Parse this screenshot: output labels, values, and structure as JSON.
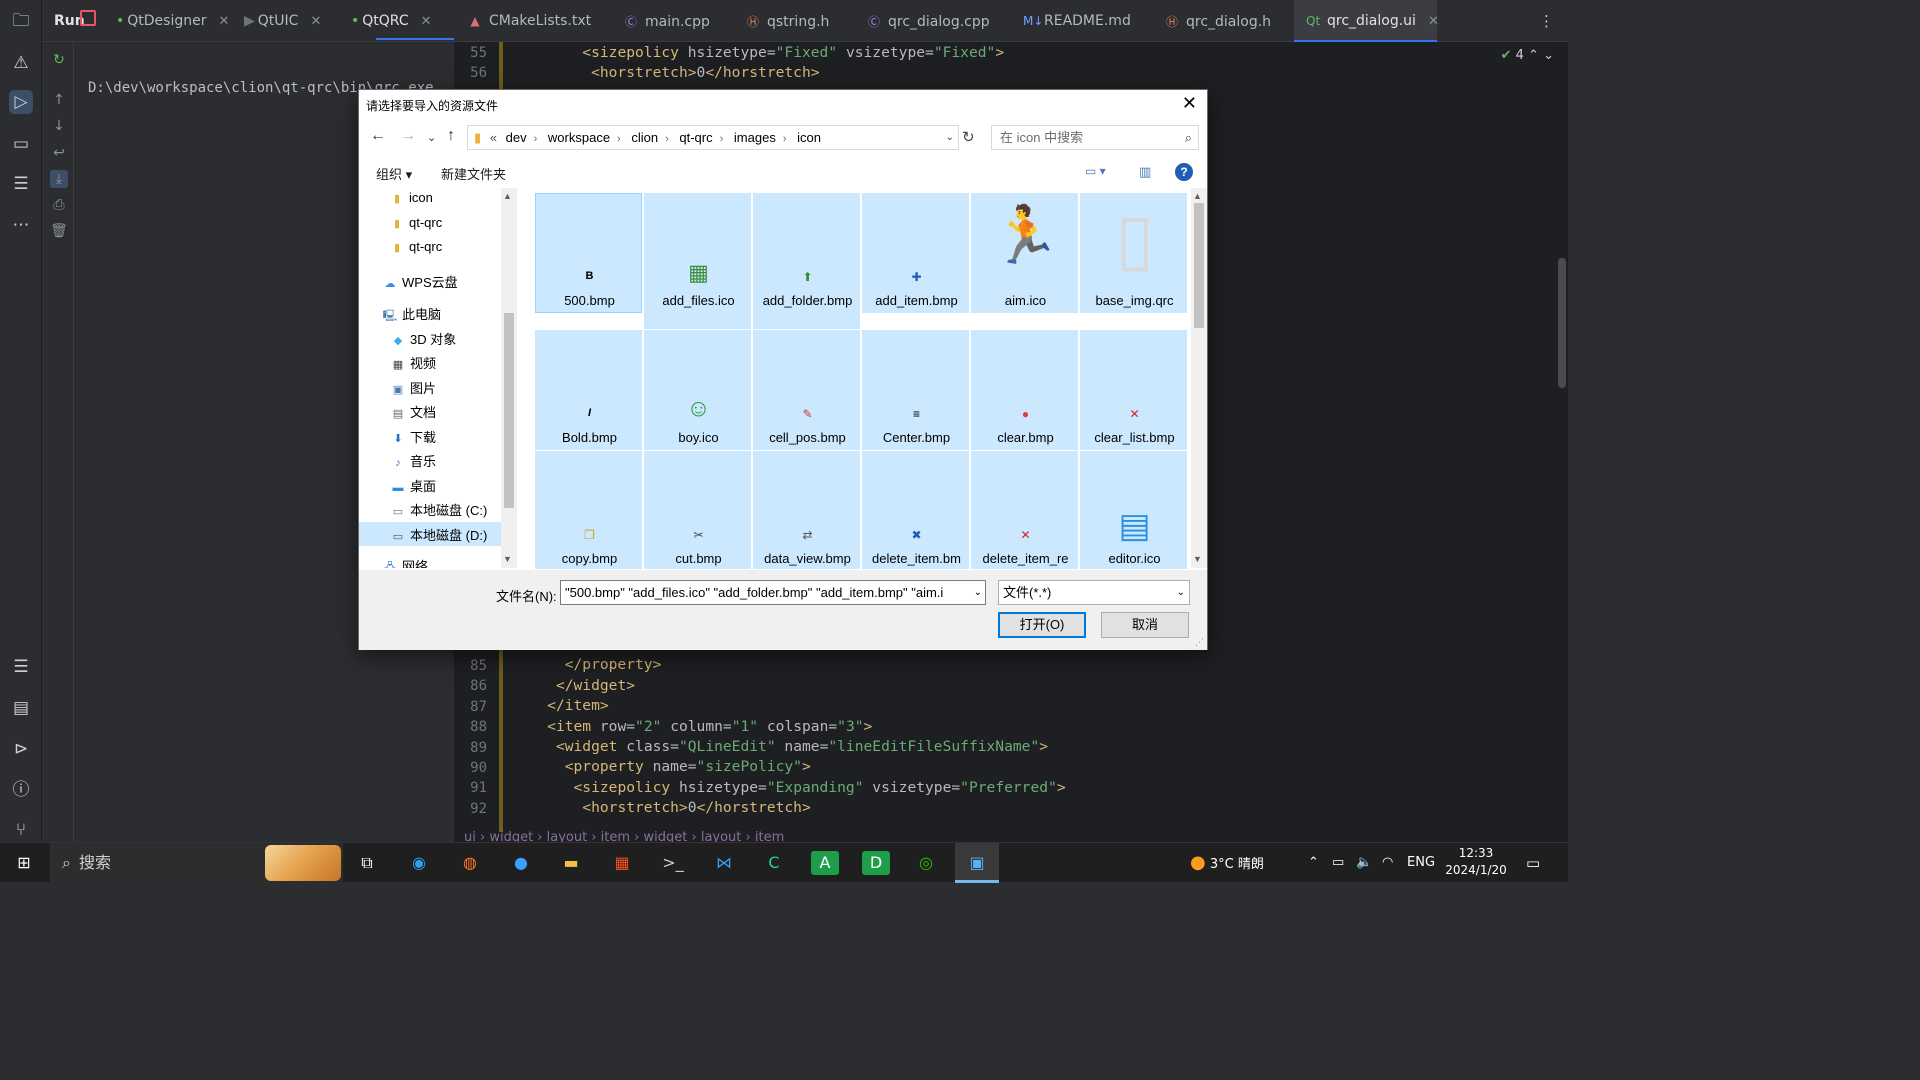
{
  "run_tool": {
    "title": "Run",
    "tabs": [
      {
        "label": "QtDesigner"
      },
      {
        "label": "QtUIC"
      },
      {
        "label": "QtQRC"
      }
    ],
    "console_line": "D:\\dev\\workspace\\clion\\qt-qrc\\bin\\qrc.exe"
  },
  "editor": {
    "tabs": [
      {
        "label": "CMakeLists.txt"
      },
      {
        "label": "main.cpp"
      },
      {
        "label": "qstring.h"
      },
      {
        "label": "qrc_dialog.cpp"
      },
      {
        "label": "README.md"
      },
      {
        "label": "qrc_dialog.h"
      },
      {
        "label": "qrc_dialog.ui"
      }
    ],
    "warnings_count": "4",
    "line_numbers": [
      "55",
      "56",
      "85",
      "86",
      "87",
      "88",
      "89",
      "90",
      "91",
      "92"
    ],
    "breadcrumb": [
      "ui",
      "widget",
      "layout",
      "item",
      "widget",
      "layout",
      "item"
    ]
  },
  "dialog": {
    "title": "请选择要导入的资源文件",
    "path": [
      "dev",
      "workspace",
      "clion",
      "qt-qrc",
      "images",
      "icon"
    ],
    "path_prefix": "«",
    "search_placeholder": "在 icon 中搜索",
    "toolbar": {
      "organize": "组织 ▾",
      "new_folder": "新建文件夹",
      "help": "?"
    },
    "tree": [
      {
        "label": "icon",
        "icon": "folder-icon"
      },
      {
        "label": "qt-qrc",
        "icon": "folder-icon"
      },
      {
        "label": "qt-qrc",
        "icon": "folder-icon"
      },
      {
        "label": "WPS云盘",
        "icon": "cloud-icon"
      },
      {
        "label": "此电脑",
        "icon": "computer-icon"
      },
      {
        "label": "3D 对象",
        "icon": "cube-icon"
      },
      {
        "label": "视频",
        "icon": "video-icon"
      },
      {
        "label": "图片",
        "icon": "picture-icon"
      },
      {
        "label": "文档",
        "icon": "document-icon"
      },
      {
        "label": "下载",
        "icon": "download-icon"
      },
      {
        "label": "音乐",
        "icon": "music-icon"
      },
      {
        "label": "桌面",
        "icon": "desktop-icon"
      },
      {
        "label": "本地磁盘 (C:)",
        "icon": "drive-icon"
      },
      {
        "label": "本地磁盘 (D:)",
        "icon": "drive-icon"
      },
      {
        "label": "网络",
        "icon": "network-icon"
      }
    ],
    "files": [
      {
        "name": "500.bmp",
        "icon": "B"
      },
      {
        "name": "add_files.ico",
        "icon": "▦"
      },
      {
        "name": "add_folder.bmp",
        "icon": "⬆"
      },
      {
        "name": "add_item.bmp",
        "icon": "✚"
      },
      {
        "name": "aim.ico",
        "icon": "🏃"
      },
      {
        "name": "base_img.qrc",
        "icon": "▯"
      },
      {
        "name": "Bold.bmp",
        "icon": "I"
      },
      {
        "name": "boy.ico",
        "icon": "☺"
      },
      {
        "name": "cell_pos.bmp",
        "icon": "✎"
      },
      {
        "name": "Center.bmp",
        "icon": "≡"
      },
      {
        "name": "clear.bmp",
        "icon": "●"
      },
      {
        "name": "clear_list.bmp",
        "icon": "✕"
      },
      {
        "name": "copy.bmp",
        "icon": "❐"
      },
      {
        "name": "cut.bmp",
        "icon": "✂"
      },
      {
        "name": "data_view.bmp",
        "icon": "⇄"
      },
      {
        "name": "delete_item.bm",
        "icon": "✖"
      },
      {
        "name": "delete_item_re",
        "icon": "✕"
      },
      {
        "name": "editor.ico",
        "icon": "▤"
      }
    ],
    "file_name_label": "文件名(N):",
    "file_name_value": "\"500.bmp\" \"add_files.ico\" \"add_folder.bmp\" \"add_item.bmp\" \"aim.i",
    "file_type": "文件(*.*)",
    "open_button": "打开(O)",
    "cancel_button": "取消"
  },
  "taskbar": {
    "search_label": "搜索",
    "weather": "3°C 晴朗",
    "ime": "ENG",
    "time": "12:33",
    "date": "2024/1/20"
  },
  "colors": {
    "accent": "#3574f0",
    "selection": "#cce8ff",
    "primary_button_border": "#0078d7"
  }
}
